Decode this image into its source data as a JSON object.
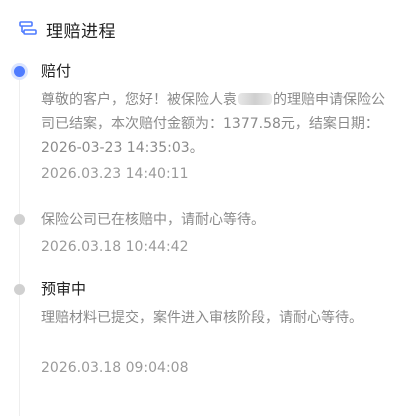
{
  "header": {
    "title": "理赔进程",
    "icon": "process-icon"
  },
  "colors": {
    "accent": "#4f7cff",
    "inactive_dot": "#d0d0d0",
    "text_primary": "#222222",
    "text_secondary": "#8a8a8a"
  },
  "timeline": [
    {
      "title": "赔付",
      "desc_part1": "尊敬的客户，您好！被保险人袁",
      "desc_part2": "的理赔申请保险公司已结案，本次赔付金额为：1377.58元，结案日期：2026-03-23 14:35:03。",
      "time": "2026.03.23 14:40:11",
      "active": true
    },
    {
      "title": "",
      "desc": "保险公司已在核赔中，请耐心等待。",
      "time": "2026.03.18 10:44:42",
      "active": false
    },
    {
      "title": "预审中",
      "desc": "理赔材料已提交，案件进入审核阶段，请耐心等待。",
      "time": "2026.03.18 09:04:08",
      "active": false
    }
  ]
}
